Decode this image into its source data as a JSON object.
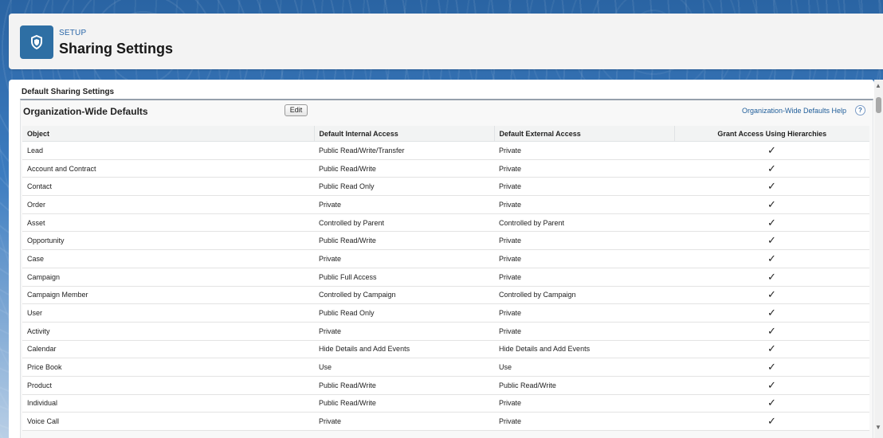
{
  "header": {
    "breadcrumb": "SETUP",
    "title": "Sharing Settings",
    "icon": "shield-icon"
  },
  "section": {
    "title": "Default Sharing Settings"
  },
  "panel": {
    "title": "Organization-Wide Defaults",
    "edit_label": "Edit",
    "help_label": "Organization-Wide Defaults Help",
    "help_icon_label": "?"
  },
  "table": {
    "columns": [
      "Object",
      "Default Internal Access",
      "Default External Access",
      "Grant Access Using Hierarchies"
    ],
    "rows": [
      {
        "object": "Lead",
        "internal": "Public Read/Write/Transfer",
        "external": "Private",
        "grant": "✓"
      },
      {
        "object": "Account and Contract",
        "internal": "Public Read/Write",
        "external": "Private",
        "grant": "✓"
      },
      {
        "object": "Contact",
        "internal": "Public Read Only",
        "external": "Private",
        "grant": "✓"
      },
      {
        "object": "Order",
        "internal": "Private",
        "external": "Private",
        "grant": "✓"
      },
      {
        "object": "Asset",
        "internal": "Controlled by Parent",
        "external": "Controlled by Parent",
        "grant": "✓"
      },
      {
        "object": "Opportunity",
        "internal": "Public Read/Write",
        "external": "Private",
        "grant": "✓"
      },
      {
        "object": "Case",
        "internal": "Private",
        "external": "Private",
        "grant": "✓"
      },
      {
        "object": "Campaign",
        "internal": "Public Full Access",
        "external": "Private",
        "grant": "✓"
      },
      {
        "object": "Campaign Member",
        "internal": "Controlled by Campaign",
        "external": "Controlled by Campaign",
        "grant": "✓"
      },
      {
        "object": "User",
        "internal": "Public Read Only",
        "external": "Private",
        "grant": "✓"
      },
      {
        "object": "Activity",
        "internal": "Private",
        "external": "Private",
        "grant": "✓"
      },
      {
        "object": "Calendar",
        "internal": "Hide Details and Add Events",
        "external": "Hide Details and Add Events",
        "grant": "✓"
      },
      {
        "object": "Price Book",
        "internal": "Use",
        "external": "Use",
        "grant": "✓"
      },
      {
        "object": "Product",
        "internal": "Public Read/Write",
        "external": "Public Read/Write",
        "grant": "✓"
      },
      {
        "object": "Individual",
        "internal": "Public Read/Write",
        "external": "Private",
        "grant": "✓"
      },
      {
        "object": "Voice Call",
        "internal": "Private",
        "external": "Private",
        "grant": "✓"
      }
    ]
  }
}
